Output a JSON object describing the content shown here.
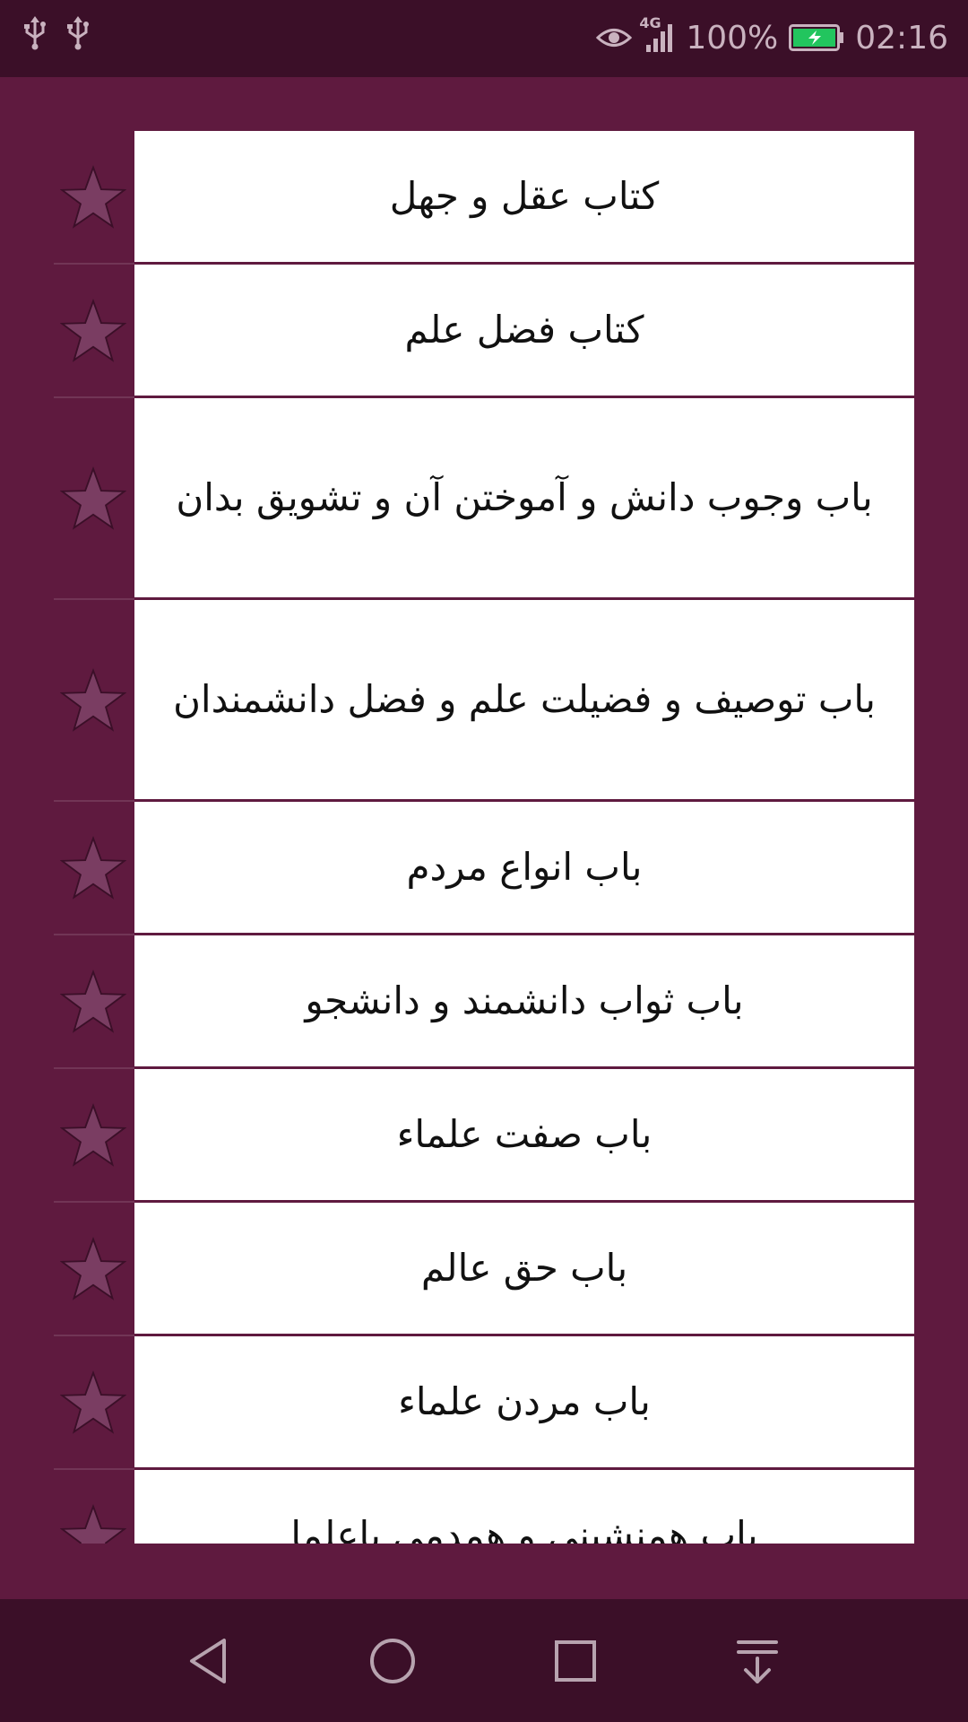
{
  "status_bar": {
    "battery": "100%",
    "time": "02:16",
    "network": "4G",
    "icons": [
      "usb-icon",
      "usb-icon",
      "eye-icon",
      "signal-icon",
      "battery-charging-icon"
    ]
  },
  "list": {
    "items": [
      {
        "label": "کتاب عقل و جهل",
        "favorite": false
      },
      {
        "label": "کتاب فضل علم",
        "favorite": false
      },
      {
        "label": "باب وجوب دانش و آموختن آن و تشویق بدان",
        "favorite": false
      },
      {
        "label": "باب توصیف و فضیلت علم و فضل دانشمندان",
        "favorite": false
      },
      {
        "label": "باب انواع مردم",
        "favorite": false
      },
      {
        "label": "باب ثواب دانشمند و دانشجو",
        "favorite": false
      },
      {
        "label": "باب صفت علماء",
        "favorite": false
      },
      {
        "label": "باب حق عالم",
        "favorite": false
      },
      {
        "label": "باب مردن علماء",
        "favorite": false
      },
      {
        "label": "باب همنشینی و همدمی باعلما",
        "favorite": false
      }
    ]
  },
  "nav_bar": {
    "icons": [
      "back-icon",
      "home-icon",
      "recents-icon",
      "notifications-pull-icon"
    ]
  },
  "colors": {
    "background": "#5f1a3f",
    "bars": "#3b0f28",
    "star": "#7a3d62",
    "card": "#ffffff"
  }
}
